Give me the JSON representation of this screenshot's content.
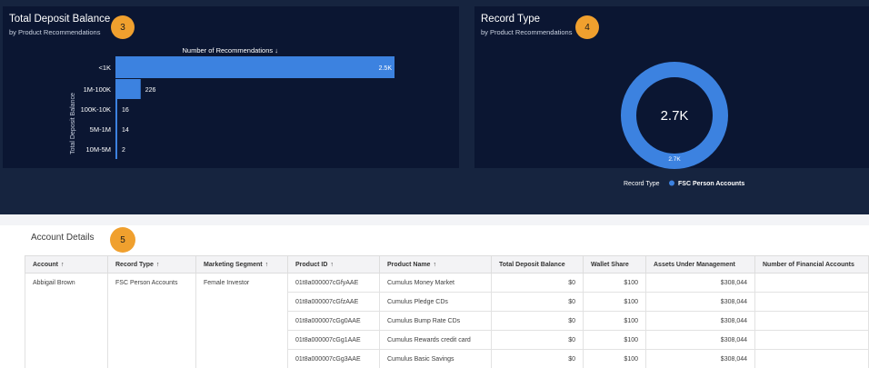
{
  "deposit_panel": {
    "title": "Total Deposit Balance",
    "subtitle": "by Product Recommendations",
    "badge": "3"
  },
  "record_panel": {
    "title": "Record Type",
    "subtitle": "by Product Recommendations",
    "badge": "4"
  },
  "details_section": {
    "title": "Account Details",
    "badge": "5"
  },
  "chart_data": [
    {
      "type": "bar",
      "orientation": "horizontal",
      "title": "Total Deposit Balance",
      "subtitle": "by Product Recommendations",
      "xlabel": "Number of Recommendations ↓",
      "ylabel": "Total Deposit Balance",
      "categories": [
        "<1K",
        "1M-100K",
        "100K-10K",
        "5M-1M",
        "10M-5M"
      ],
      "values": [
        2500,
        226,
        16,
        14,
        2
      ],
      "value_labels": [
        "2.5K",
        "226",
        "16",
        "14",
        "2"
      ],
      "xlim": [
        0,
        2500
      ],
      "grid": false
    },
    {
      "type": "pie",
      "variant": "donut",
      "title": "Record Type",
      "subtitle": "by Product Recommendations",
      "center_label": "2.7K",
      "slices": [
        {
          "label": "FSC Person Accounts",
          "value": 2700,
          "value_label": "2.7K"
        }
      ],
      "legend_title": "Record Type",
      "legend_position": "bottom",
      "colors": [
        "#3c82e0"
      ]
    }
  ],
  "table": {
    "columns": [
      {
        "label": "Account",
        "sort": "↑"
      },
      {
        "label": "Record Type",
        "sort": "↑"
      },
      {
        "label": "Marketing Segment",
        "sort": "↑"
      },
      {
        "label": "Product ID",
        "sort": "↑"
      },
      {
        "label": "Product Name",
        "sort": "↑"
      },
      {
        "label": "Total Deposit Balance",
        "sort": ""
      },
      {
        "label": "Wallet Share",
        "sort": ""
      },
      {
        "label": "Assets Under Management",
        "sort": ""
      },
      {
        "label": "Number of Financial Accounts",
        "sort": ""
      }
    ],
    "group": {
      "account": "Abbigail Brown",
      "record_type": "FSC Person Accounts",
      "marketing_segment": "Female Investor"
    },
    "rows": [
      {
        "product_id": "01t8a000007cGfyAAE",
        "product_name": "Cumulus Money Market",
        "deposit": "$0",
        "wallet": "$100",
        "aum": "$308,044",
        "fin_accounts": ""
      },
      {
        "product_id": "01t8a000007cGfzAAE",
        "product_name": "Cumulus Pledge CDs",
        "deposit": "$0",
        "wallet": "$100",
        "aum": "$308,044",
        "fin_accounts": ""
      },
      {
        "product_id": "01t8a000007cGg0AAE",
        "product_name": "Cumulus Bump Rate CDs",
        "deposit": "$0",
        "wallet": "$100",
        "aum": "$308,044",
        "fin_accounts": ""
      },
      {
        "product_id": "01t8a000007cGg1AAE",
        "product_name": "Cumulus Rewards credit card",
        "deposit": "$0",
        "wallet": "$100",
        "aum": "$308,044",
        "fin_accounts": ""
      },
      {
        "product_id": "01t8a000007cGg3AAE",
        "product_name": "Cumulus Basic Savings",
        "deposit": "$0",
        "wallet": "$100",
        "aum": "$308,044",
        "fin_accounts": ""
      }
    ]
  },
  "colors": {
    "dashboard_background": "#16243f",
    "panel_background": "#0b1632",
    "bar": "#3c82e0",
    "badge": "#f0a02e"
  }
}
